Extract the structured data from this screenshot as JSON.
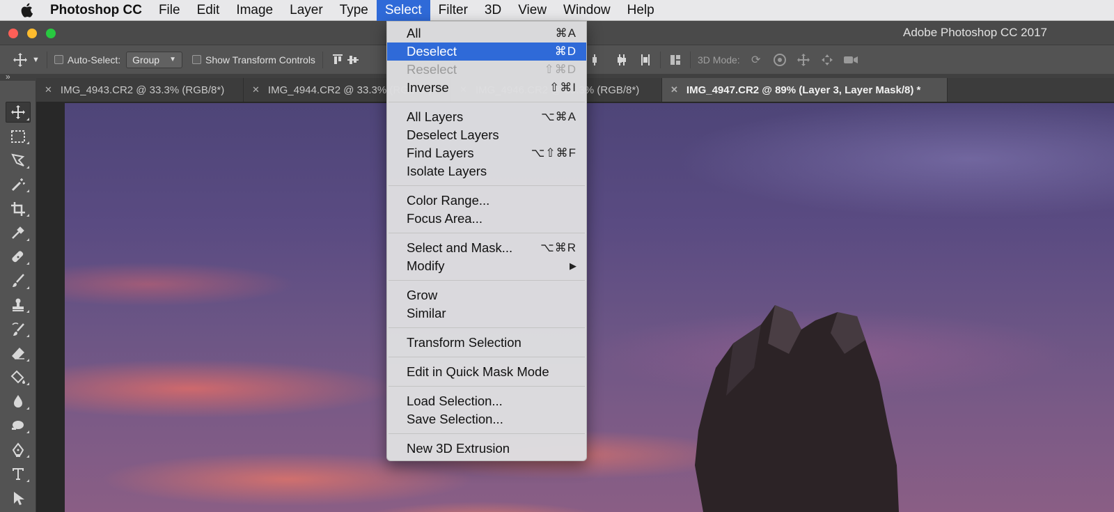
{
  "menubar": {
    "app_name": "Photoshop CC",
    "menus": [
      "File",
      "Edit",
      "Image",
      "Layer",
      "Type",
      "Select",
      "Filter",
      "3D",
      "View",
      "Window",
      "Help"
    ],
    "active_menu": "Select"
  },
  "window": {
    "title": "Adobe Photoshop CC 2017"
  },
  "options": {
    "auto_select_label": "Auto-Select:",
    "auto_select_value": "Group",
    "show_transform_label": "Show Transform Controls",
    "mode_3d_label": "3D Mode:"
  },
  "tabs": [
    {
      "label": "IMG_4943.CR2 @ 33.3% (RGB/8*)",
      "active": false
    },
    {
      "label": "IMG_4944.CR2 @ 33.3% (RGB/8*)",
      "active": false
    },
    {
      "label": "IMG_4946.CR2 @ 33.3% (RGB/8*)",
      "active": false
    },
    {
      "label": "IMG_4947.CR2 @ 89% (Layer 3, Layer Mask/8) *",
      "active": true
    }
  ],
  "select_menu": {
    "groups": [
      [
        {
          "label": "All",
          "shortcut": "⌘A",
          "state": "normal"
        },
        {
          "label": "Deselect",
          "shortcut": "⌘D",
          "state": "highlighted"
        },
        {
          "label": "Reselect",
          "shortcut": "⇧⌘D",
          "state": "disabled"
        },
        {
          "label": "Inverse",
          "shortcut": "⇧⌘I",
          "state": "normal"
        }
      ],
      [
        {
          "label": "All Layers",
          "shortcut": "⌥⌘A",
          "state": "normal"
        },
        {
          "label": "Deselect Layers",
          "shortcut": "",
          "state": "normal"
        },
        {
          "label": "Find Layers",
          "shortcut": "⌥⇧⌘F",
          "state": "normal"
        },
        {
          "label": "Isolate Layers",
          "shortcut": "",
          "state": "normal"
        }
      ],
      [
        {
          "label": "Color Range...",
          "shortcut": "",
          "state": "normal"
        },
        {
          "label": "Focus Area...",
          "shortcut": "",
          "state": "normal"
        }
      ],
      [
        {
          "label": "Select and Mask...",
          "shortcut": "⌥⌘R",
          "state": "normal"
        },
        {
          "label": "Modify",
          "shortcut": "▶",
          "state": "submenu"
        }
      ],
      [
        {
          "label": "Grow",
          "shortcut": "",
          "state": "normal"
        },
        {
          "label": "Similar",
          "shortcut": "",
          "state": "normal"
        }
      ],
      [
        {
          "label": "Transform Selection",
          "shortcut": "",
          "state": "normal"
        }
      ],
      [
        {
          "label": "Edit in Quick Mask Mode",
          "shortcut": "",
          "state": "normal"
        }
      ],
      [
        {
          "label": "Load Selection...",
          "shortcut": "",
          "state": "normal"
        },
        {
          "label": "Save Selection...",
          "shortcut": "",
          "state": "normal"
        }
      ],
      [
        {
          "label": "New 3D Extrusion",
          "shortcut": "",
          "state": "normal"
        }
      ]
    ]
  },
  "toolbar": {
    "tools": [
      "move-tool",
      "marquee-tool",
      "lasso-tool",
      "magic-wand-tool",
      "crop-tool",
      "eyedropper-tool",
      "healing-brush-tool",
      "brush-tool",
      "clone-stamp-tool",
      "history-brush-tool",
      "eraser-tool",
      "paint-bucket-tool",
      "blur-tool",
      "dodge-tool",
      "pen-tool",
      "type-tool",
      "path-selection-tool"
    ],
    "selected": "move-tool"
  }
}
